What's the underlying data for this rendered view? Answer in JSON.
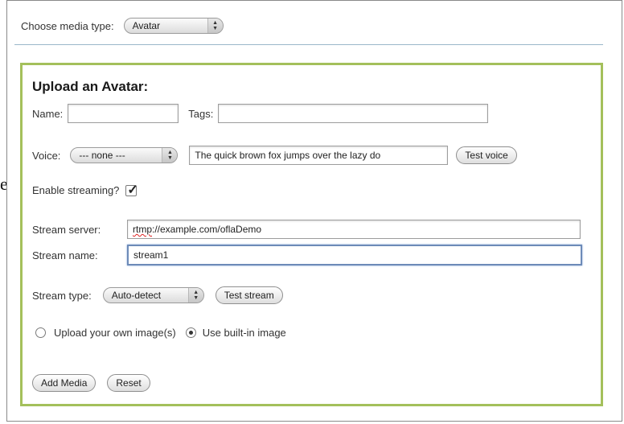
{
  "stray_glyph": "e",
  "media_type": {
    "label": "Choose media type:",
    "selected": "Avatar"
  },
  "form": {
    "title": "Upload an Avatar:",
    "name_label": "Name:",
    "name_value": "",
    "tags_label": "Tags:",
    "tags_value": "",
    "voice_label": "Voice:",
    "voice_selected": "--- none ---",
    "voice_text": "The quick brown fox jumps over the lazy do",
    "test_voice": "Test voice",
    "streaming_label": "Enable streaming?",
    "streaming_checked": true,
    "server_label": "Stream server:",
    "server_value_prefix": "rtmp",
    "server_value_rest": "://example.com/oflaDemo",
    "stream_name_label": "Stream name:",
    "stream_name_value": "stream1",
    "stream_type_label": "Stream type:",
    "stream_type_selected": "Auto-detect",
    "test_stream": "Test stream",
    "upload_own_label": "Upload your own image(s)",
    "builtin_label": "Use built-in image",
    "image_choice": "builtin",
    "add_media": "Add Media",
    "reset": "Reset"
  },
  "colors": {
    "panel_border": "#a4c05b",
    "divider": "#9bb7c9",
    "focus": "#6d8bb8"
  }
}
